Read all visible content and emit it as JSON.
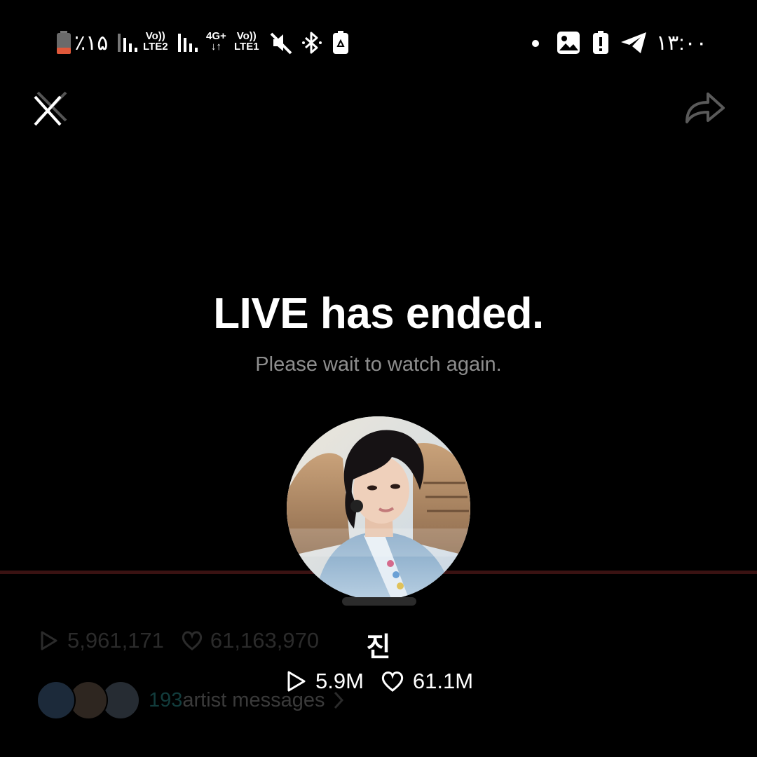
{
  "status_bar": {
    "battery_percent": "٪۱۵",
    "sim2_label_top": "Vo))",
    "sim2_label_bottom": "LTE2",
    "net_label_top": "4G+",
    "net_label_bottom": "↓↑",
    "sim1_label_top": "Vo))",
    "sim1_label_bottom": "LTE1",
    "time": "۱۳:۰۰"
  },
  "player": {
    "title": "LIVE has ended.",
    "subtitle": "Please wait to watch again."
  },
  "artist": {
    "name": "진",
    "plays_short": "5.9M",
    "likes_short": "61.1M"
  },
  "background_info": {
    "plays": "5,961,171",
    "likes": "61,163,970",
    "messages_count": "193",
    "messages_label": "artist messages"
  },
  "colors": {
    "background": "#000000",
    "subtitle": "#8e8e8e",
    "progress_line": "#3a1212",
    "battery_low": "#e0583a"
  },
  "icons": {
    "close": "close-icon",
    "share": "share-icon",
    "play": "play-icon",
    "heart": "heart-icon"
  }
}
